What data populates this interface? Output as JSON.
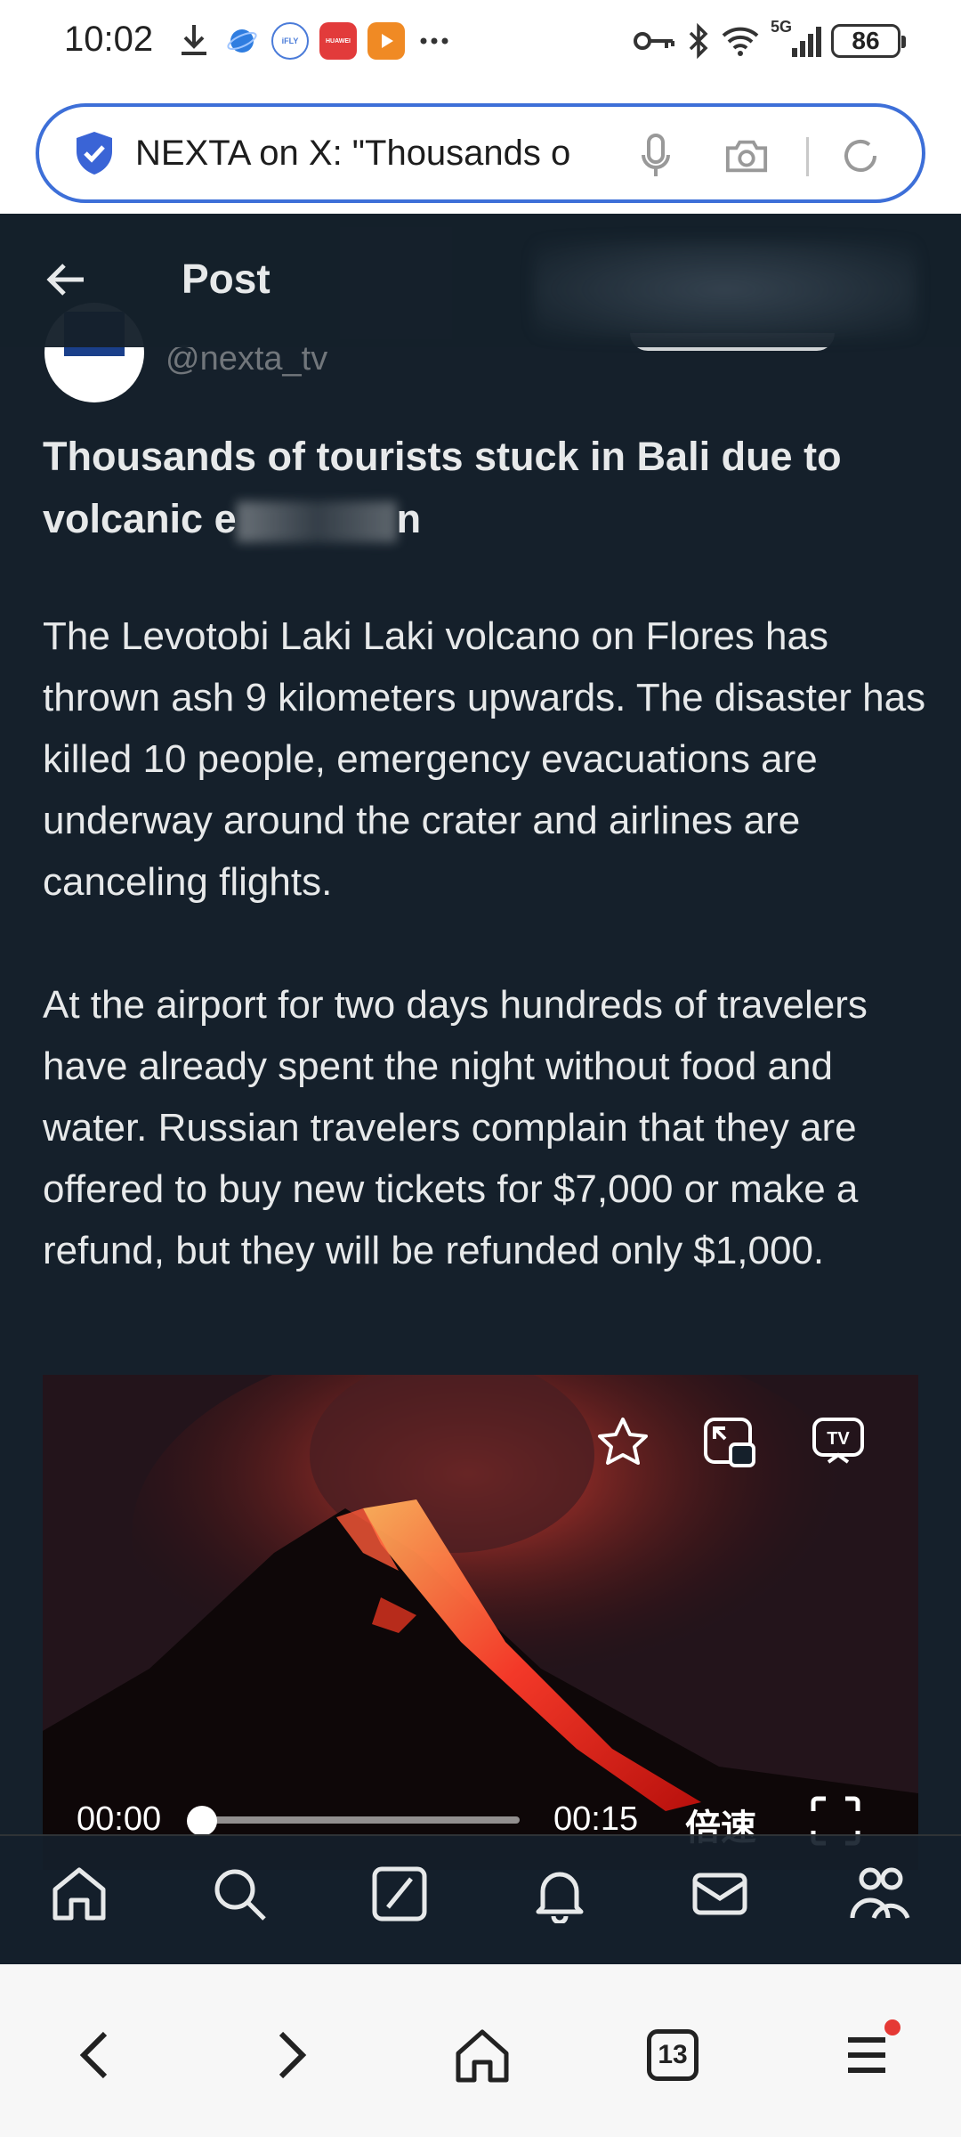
{
  "status_bar": {
    "time": "10:02",
    "network": "5G",
    "battery": "86",
    "app_badges": [
      "iFLY",
      "HUAWEI"
    ]
  },
  "browser": {
    "address_text": "NEXTA on X: \"Thousands o",
    "tab_count": "13"
  },
  "post": {
    "header_title": "Post",
    "handle": "@nexta_tv",
    "headline_start": "Thousands of tourists stuck in Bali due to volcanic e",
    "headline_end": "n",
    "paragraph1": "The Levotobi Laki Laki volcano on Flores has thrown ash 9 kilometers upwards. The disaster has killed 10 people, emergency evacuations are underway around the crater and airlines are canceling flights.",
    "paragraph2": "At the airport for two days hundreds of travelers have already spent the night without food and water. Russian travelers complain that they are offered to buy new tickets for $7,000 or make a refund, but they will be refunded only $1,000."
  },
  "video": {
    "current_time": "00:00",
    "total_time": "00:15",
    "speed_label": "倍速",
    "progress": 0
  },
  "x_nav": [
    "home-icon",
    "search-icon",
    "grok-icon",
    "notifications-icon",
    "messages-icon",
    "communities-icon"
  ],
  "browser_nav": [
    "back-icon",
    "forward-icon",
    "home-icon",
    "tabs-icon",
    "menu-icon"
  ],
  "colors": {
    "page_bg": "#15202b",
    "text": "#e7e9ea",
    "secondary_text": "#71767b",
    "accent": "#3d6fd8"
  }
}
